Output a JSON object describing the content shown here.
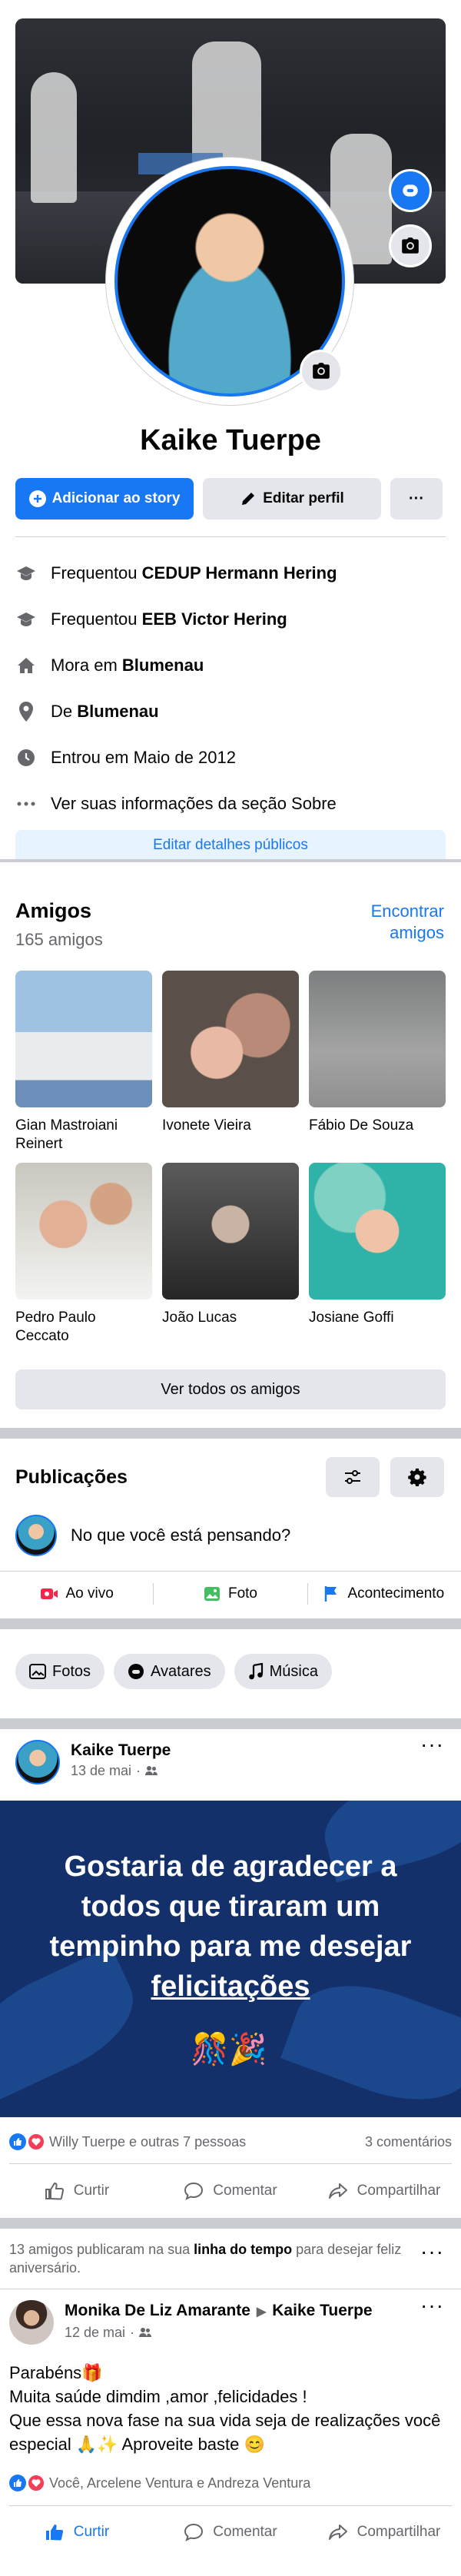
{
  "profile": {
    "name": "Kaike Tuerpe",
    "add_story_label": "Adicionar ao story",
    "edit_profile_label": "Editar perfil",
    "more_label": "···"
  },
  "about": [
    {
      "icon": "graduation-cap-icon",
      "prefix": "Frequentou ",
      "bold": "CEDUP Hermann Hering"
    },
    {
      "icon": "graduation-cap-icon",
      "prefix": "Frequentou ",
      "bold": "EEB Victor Hering"
    },
    {
      "icon": "home-icon",
      "prefix": "Mora em ",
      "bold": "Blumenau"
    },
    {
      "icon": "location-pin-icon",
      "prefix": "De ",
      "bold": "Blumenau"
    },
    {
      "icon": "clock-icon",
      "prefix": "Entrou em Maio de 2012",
      "bold": ""
    },
    {
      "icon": "ellipsis-icon",
      "prefix": "Ver suas informações da seção Sobre",
      "bold": ""
    }
  ],
  "edit_public_label": "Editar detalhes públicos",
  "friends": {
    "title": "Amigos",
    "count": "165 amigos",
    "find_label": "Encontrar amigos",
    "see_all_label": "Ver todos os amigos",
    "items": [
      {
        "name": "Gian Mastroiani Reinert",
        "color": "#6b8fb8"
      },
      {
        "name": "Ivonete Vieira",
        "color": "#b98a78"
      },
      {
        "name": "Fábio De Souza",
        "color": "#8f8f8f"
      },
      {
        "name": "Pedro Paulo Ceccato",
        "color": "#a4a39a"
      },
      {
        "name": "João Lucas",
        "color": "#3d3d3d"
      },
      {
        "name": "Josiane Goffi",
        "color": "#2fb3a8"
      }
    ]
  },
  "posts": {
    "title": "Publicações",
    "composer_placeholder": "No que você está pensando?",
    "quick_actions": [
      "Ao vivo",
      "Foto",
      "Acontecimento"
    ],
    "chips": [
      "Fotos",
      "Avatares",
      "Música"
    ]
  },
  "post1": {
    "author": "Kaike Tuerpe",
    "date": "13 de mai",
    "banner_line1": "Gostaria de agradecer a todos que tiraram um tempinho para me desejar",
    "banner_line2": "felicitações",
    "reactions_text": "Willy Tuerpe e outras 7 pessoas",
    "comments_text": "3 comentários",
    "like_label": "Curtir",
    "comment_label": "Comentar",
    "share_label": "Compartilhar"
  },
  "notice": {
    "part1": "13 amigos publicaram na sua ",
    "bold": "linha do tempo",
    "part2": " para desejar feliz aniversário."
  },
  "post2": {
    "author": "Monika De Liz Amarante",
    "target": "Kaike Tuerpe",
    "date": "12 de mai",
    "line1": "Parabéns🎁",
    "line2": "Muita saúde dimdim ,amor ,felicidades !",
    "line3": "Que essa nova fase na sua vida seja de realizações você especial 🙏✨ Aproveite baste 😊",
    "reactions_text": "Você, Arcelene Ventura e Andreza Ventura",
    "like_label": "Curtir",
    "comment_label": "Comentar",
    "share_label": "Compartilhar"
  },
  "colors": {
    "accent": "#1877f2",
    "secondary_bg": "#e4e6eb",
    "muted_text": "#65676b",
    "live_red": "#f02849",
    "photo_green": "#45bd62",
    "event_blue": "#1877f2"
  }
}
